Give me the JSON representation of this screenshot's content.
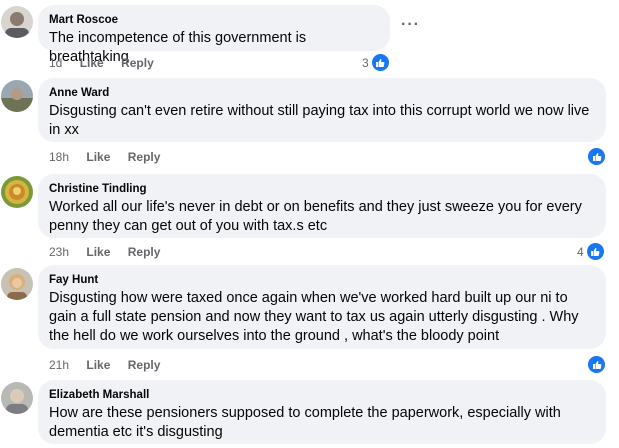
{
  "comments": [
    {
      "author": "Mart Roscoe",
      "text": "The incompetence of this government is breathtaking",
      "time": "1d",
      "like_label": "Like",
      "reply_label": "Reply",
      "reactions": "3"
    },
    {
      "author": "Anne Ward",
      "text": "Disgusting can't even retire without still paying tax into this corrupt world we now live in xx",
      "time": "18h",
      "like_label": "Like",
      "reply_label": "Reply",
      "reactions": ""
    },
    {
      "author": "Christine Tindling",
      "text": "Worked all our life's never in debt or on benefits and they just sweeze you for every penny they can get out of you with tax.s etc",
      "time": "23h",
      "like_label": "Like",
      "reply_label": "Reply",
      "reactions": "4"
    },
    {
      "author": "Fay Hunt",
      "text": "Disgusting how were taxed once again when we've worked hard built up our ni to gain a full state pension and now they want to tax us again utterly disgusting . Why the hell do we work ourselves into the ground , what's the bloody point",
      "time": "21h",
      "like_label": "Like",
      "reply_label": "Reply",
      "reactions": ""
    },
    {
      "author": "Elizabeth Marshall",
      "text": "How are these pensioners supposed to complete the paperwork, especially with dementia etc it's disgusting",
      "time": "",
      "like_label": "",
      "reply_label": "",
      "reactions": ""
    }
  ],
  "more_options": "···",
  "colors": {
    "bubble": "#f0f2f5",
    "like_blue": "#1877f2",
    "meta": "#65676b"
  }
}
